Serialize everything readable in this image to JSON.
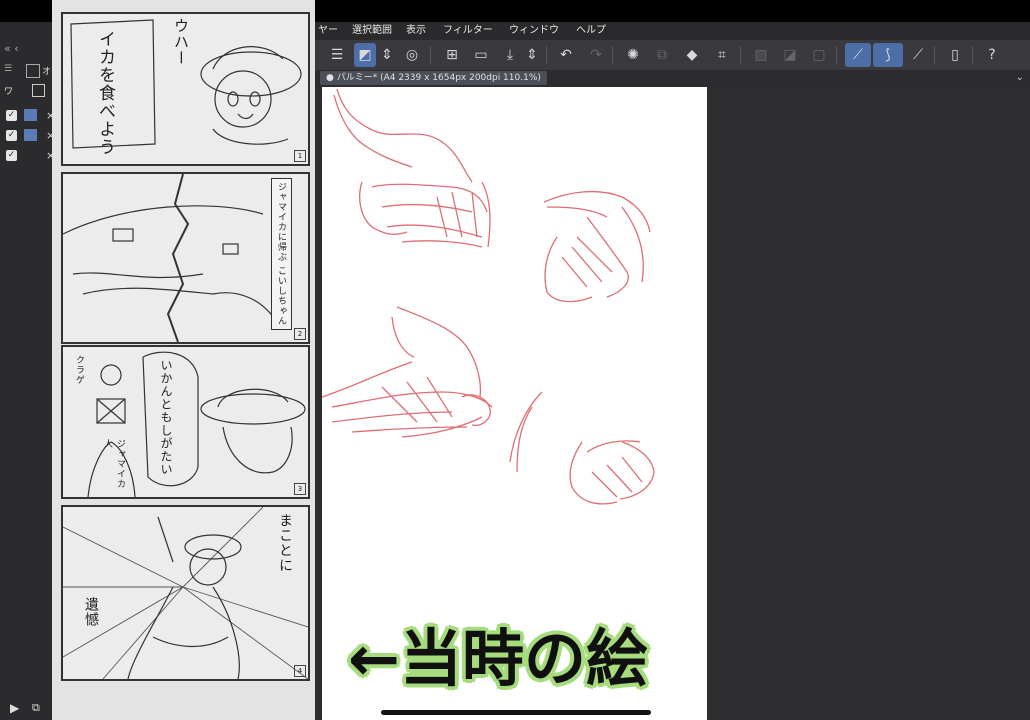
{
  "menu": {
    "items": [
      {
        "label": "ヤー"
      },
      {
        "label": "選択範囲"
      },
      {
        "label": "表示"
      },
      {
        "label": "フィルター"
      },
      {
        "label": "ウィンドウ"
      },
      {
        "label": "ヘルプ"
      }
    ]
  },
  "toolbar": {
    "icons": [
      "menu-icon",
      "layer-select-icon",
      "up-down-icon",
      "lasso-icon",
      "new-layer-icon",
      "open-folder-icon",
      "save-icon",
      "up-down-icon",
      "undo-icon",
      "redo-icon",
      "loading-icon",
      "transform-icon",
      "fill-icon",
      "crop-icon",
      "layer-mask-icon",
      "mask-icon",
      "frame-icon",
      "ruler-icon",
      "brush-icon",
      "pen-icon",
      "device-icon",
      "help-icon"
    ]
  },
  "document": {
    "tab_label": "パルミー* (A4 2339 x 1654px 200dpi 110.1%)"
  },
  "left_dock": {
    "panel_label": "オ",
    "small_label": "ワ"
  },
  "manga": {
    "panel1": {
      "bubble": "イカを食べよう",
      "shout": "ウハー",
      "number": "1"
    },
    "panel2": {
      "caption": "ジャマイカに帰ぶ こいしちゃん",
      "number": "2"
    },
    "panel3": {
      "bubble": "いかんともしがたい",
      "label_kurage": "クラゲ",
      "label_jamaican": "ジャマイカ人",
      "number": "3"
    },
    "panel4": {
      "text": "まことに",
      "side": "遺憾",
      "number": "4"
    }
  },
  "caption": {
    "text": "←当時の絵"
  },
  "colors": {
    "accent": "#4d6fa8",
    "sketch": "#d9545a",
    "caption_outline": "#a6dc7e"
  }
}
